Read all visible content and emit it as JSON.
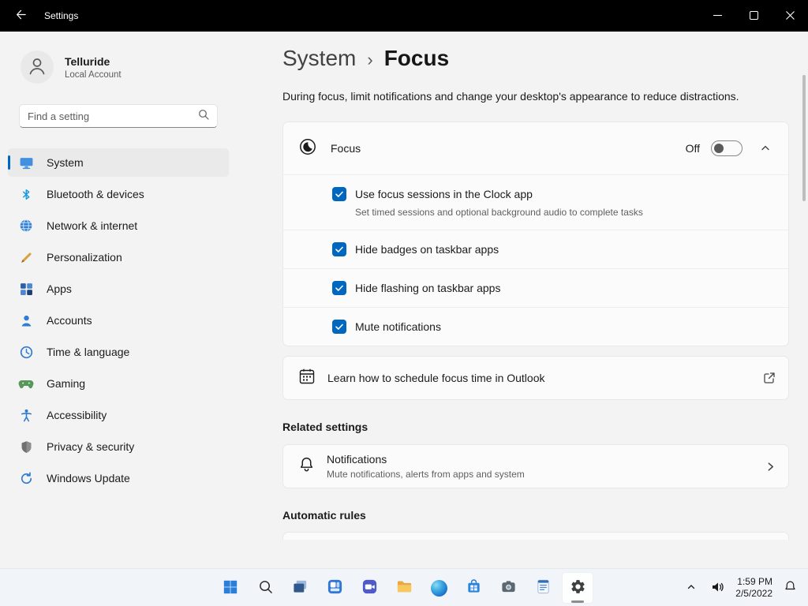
{
  "window": {
    "title": "Settings"
  },
  "sidebar": {
    "user": {
      "name": "Telluride",
      "account_type": "Local Account"
    },
    "search": {
      "placeholder": "Find a setting"
    },
    "items": [
      {
        "label": "System",
        "icon": "system-icon",
        "selected": true
      },
      {
        "label": "Bluetooth & devices",
        "icon": "bluetooth-icon",
        "selected": false
      },
      {
        "label": "Network & internet",
        "icon": "network-icon",
        "selected": false
      },
      {
        "label": "Personalization",
        "icon": "personalization-icon",
        "selected": false
      },
      {
        "label": "Apps",
        "icon": "apps-icon",
        "selected": false
      },
      {
        "label": "Accounts",
        "icon": "accounts-icon",
        "selected": false
      },
      {
        "label": "Time & language",
        "icon": "time-language-icon",
        "selected": false
      },
      {
        "label": "Gaming",
        "icon": "gaming-icon",
        "selected": false
      },
      {
        "label": "Accessibility",
        "icon": "accessibility-icon",
        "selected": false
      },
      {
        "label": "Privacy & security",
        "icon": "privacy-icon",
        "selected": false
      },
      {
        "label": "Windows Update",
        "icon": "windows-update-icon",
        "selected": false
      }
    ]
  },
  "main": {
    "breadcrumb": {
      "root": "System",
      "separator": "›",
      "current": "Focus"
    },
    "description": "During focus, limit notifications and change your desktop's appearance to reduce distractions.",
    "focus": {
      "label": "Focus",
      "toggle_state": "Off"
    },
    "options": [
      {
        "label": "Use focus sessions in the Clock app",
        "sublabel": "Set timed sessions and optional background audio to complete tasks",
        "checked": true
      },
      {
        "label": "Hide badges on taskbar apps",
        "checked": true
      },
      {
        "label": "Hide flashing on taskbar apps",
        "checked": true
      },
      {
        "label": "Mute notifications",
        "checked": true
      }
    ],
    "outlook_link": {
      "label": "Learn how to schedule focus time in Outlook"
    },
    "related_settings_heading": "Related settings",
    "notifications": {
      "label": "Notifications",
      "sublabel": "Mute notifications, alerts from apps and system"
    },
    "automatic_rules_heading": "Automatic rules"
  },
  "taskbar": {
    "clock": {
      "time": "1:59 PM",
      "date": "2/5/2022"
    }
  },
  "colors": {
    "accent": "#0067c0",
    "titlebar": "#000000",
    "card": "#fbfbfb",
    "background": "#f3f3f3"
  }
}
